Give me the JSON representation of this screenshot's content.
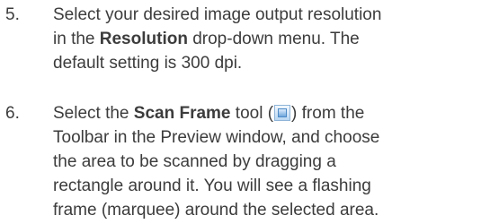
{
  "steps": [
    {
      "number": "5.",
      "lines": [
        [
          "Select your desired image output resolution"
        ],
        [
          "in the ",
          "Resolution",
          " drop-down menu.  The"
        ],
        [
          "default setting is 300 dpi."
        ]
      ]
    },
    {
      "number": "6.",
      "line1_a": "Select the ",
      "line1_bold": "Scan Frame",
      "line1_b": " tool (",
      "icon": "scan-frame-icon",
      "line1_c": ") from the",
      "lines": [
        "Toolbar in the Preview window, and choose",
        "the area to be scanned by dragging a",
        "rectangle around it.  You will see a flashing",
        "frame (marquee) around the selected area."
      ]
    }
  ]
}
